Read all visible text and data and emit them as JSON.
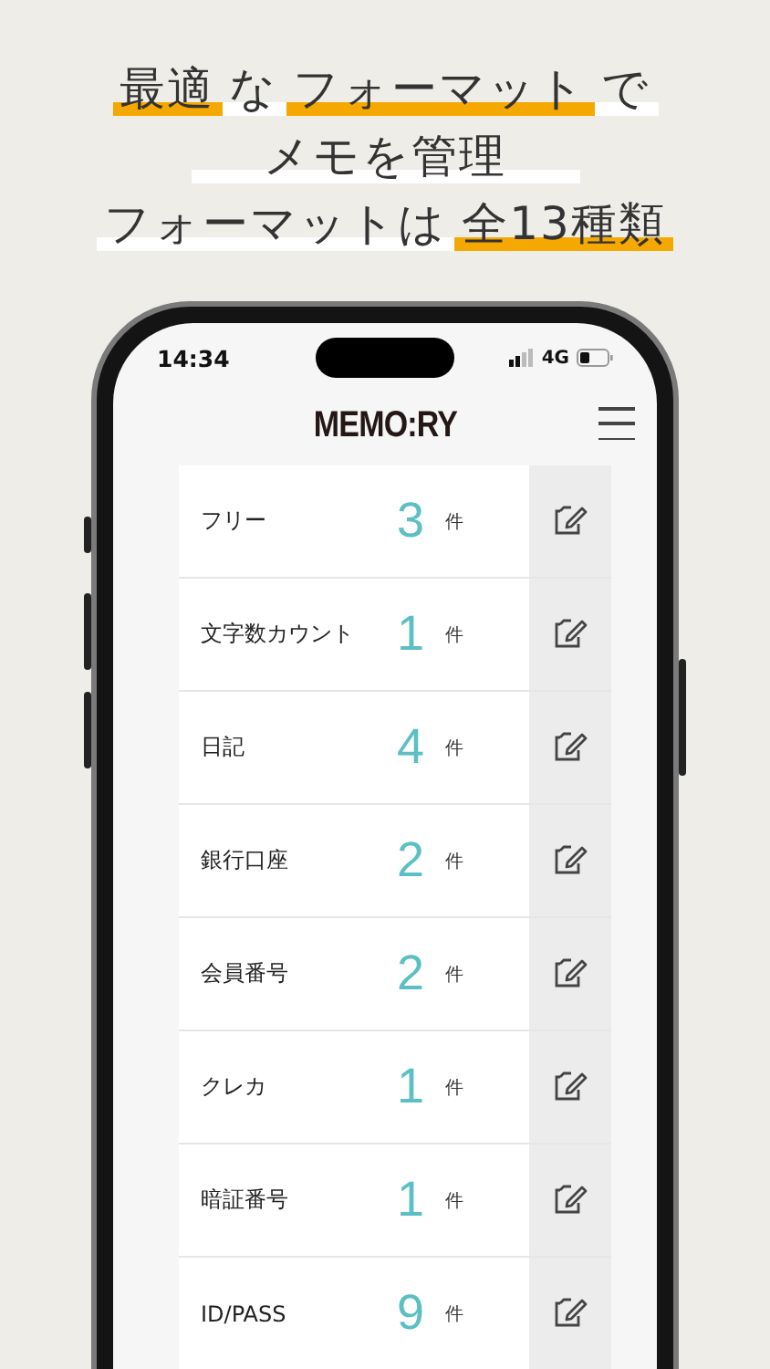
{
  "headline": [
    {
      "segments": [
        {
          "text": "最適",
          "color": "#f5a800"
        },
        {
          "text": "な",
          "color": "#ffffff"
        },
        {
          "text": "フォーマット",
          "color": "#f5a800"
        },
        {
          "text": "で",
          "color": "#ffffff"
        }
      ]
    },
    {
      "segments": [
        {
          "text": "メモを管理",
          "color": "#ffffff"
        }
      ]
    },
    {
      "segments": [
        {
          "text": "フォーマットは",
          "color": "#ffffff"
        },
        {
          "text": "全13種類",
          "color": "#f5a800"
        }
      ]
    }
  ],
  "status_bar": {
    "time": "14:34",
    "network": "4G"
  },
  "app": {
    "logo": "MEMO:RY"
  },
  "formats": [
    {
      "name": "フリー",
      "count": "3",
      "unit": "件"
    },
    {
      "name": "文字数カウント",
      "count": "1",
      "unit": "件"
    },
    {
      "name": "日記",
      "count": "4",
      "unit": "件"
    },
    {
      "name": "銀行口座",
      "count": "2",
      "unit": "件"
    },
    {
      "name": "会員番号",
      "count": "2",
      "unit": "件"
    },
    {
      "name": "クレカ",
      "count": "1",
      "unit": "件"
    },
    {
      "name": "暗証番号",
      "count": "1",
      "unit": "件"
    },
    {
      "name": "ID/PASS",
      "count": "9",
      "unit": "件"
    }
  ]
}
